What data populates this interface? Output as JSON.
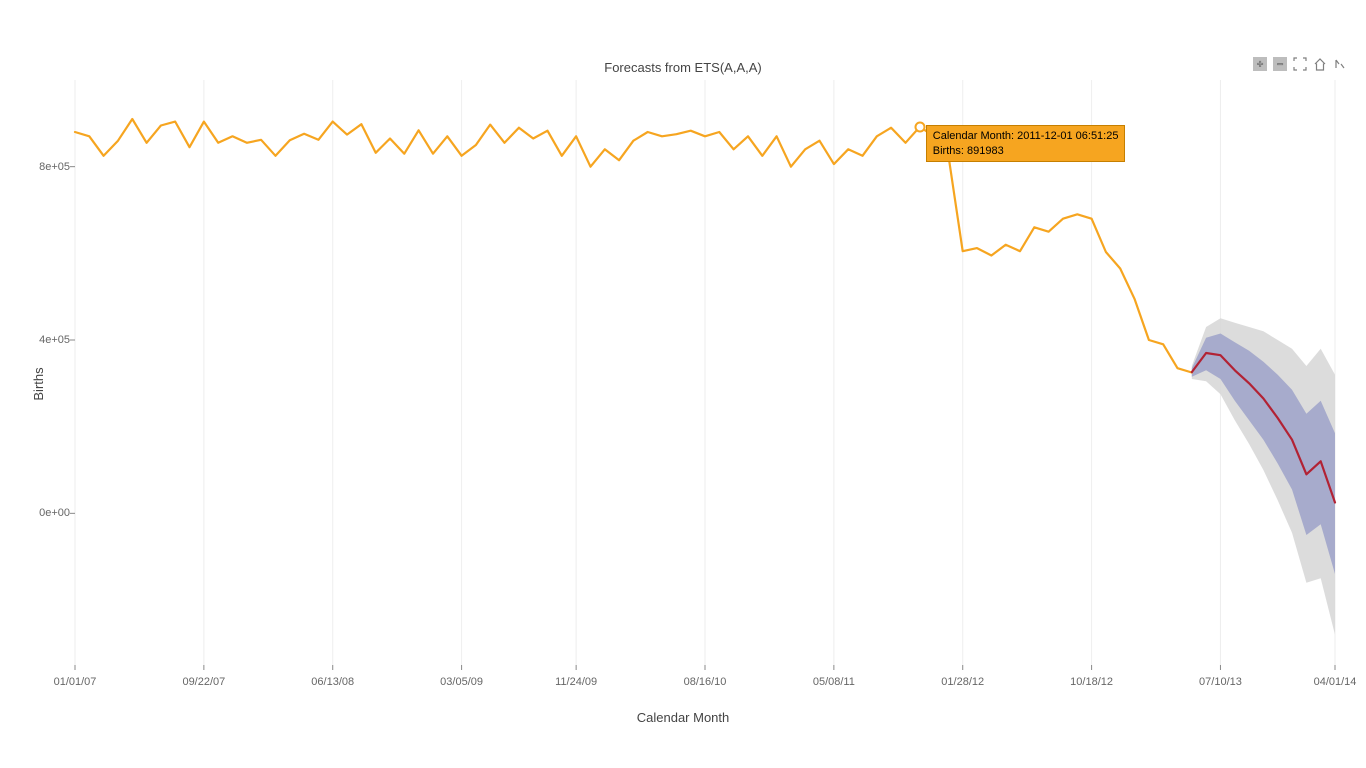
{
  "chart_data": {
    "type": "line",
    "title": "Forecasts from ETS(A,A,A)",
    "xlabel": "Calendar Month",
    "ylabel": "Births",
    "ylim": [
      -350000,
      1000000
    ],
    "xlim": [
      0,
      88
    ],
    "y_ticks": [
      {
        "v": 0,
        "label": "0e+00"
      },
      {
        "v": 400000,
        "label": "4e+05"
      },
      {
        "v": 800000,
        "label": "8e+05"
      }
    ],
    "x_ticks": [
      {
        "i": 0,
        "label": "01/01/07"
      },
      {
        "i": 9,
        "label": "09/22/07"
      },
      {
        "i": 18,
        "label": "06/13/08"
      },
      {
        "i": 27,
        "label": "03/05/09"
      },
      {
        "i": 35,
        "label": "11/24/09"
      },
      {
        "i": 44,
        "label": "08/16/10"
      },
      {
        "i": 53,
        "label": "05/08/11"
      },
      {
        "i": 62,
        "label": "01/28/12"
      },
      {
        "i": 71,
        "label": "10/18/12"
      },
      {
        "i": 80,
        "label": "07/10/13"
      },
      {
        "i": 88,
        "label": "04/01/14"
      }
    ],
    "series": [
      {
        "name": "Births",
        "color": "#f6a520",
        "values": [
          [
            0,
            880000
          ],
          [
            1,
            870000
          ],
          [
            2,
            825000
          ],
          [
            3,
            860000
          ],
          [
            4,
            910000
          ],
          [
            5,
            855000
          ],
          [
            6,
            895000
          ],
          [
            7,
            904000
          ],
          [
            8,
            845000
          ],
          [
            9,
            904000
          ],
          [
            10,
            855000
          ],
          [
            11,
            870000
          ],
          [
            12,
            855000
          ],
          [
            13,
            862000
          ],
          [
            14,
            825000
          ],
          [
            15,
            861000
          ],
          [
            16,
            876000
          ],
          [
            17,
            862000
          ],
          [
            18,
            904000
          ],
          [
            19,
            874000
          ],
          [
            20,
            898000
          ],
          [
            21,
            832000
          ],
          [
            22,
            865000
          ],
          [
            23,
            830000
          ],
          [
            24,
            884000
          ],
          [
            25,
            830000
          ],
          [
            26,
            870000
          ],
          [
            27,
            825000
          ],
          [
            28,
            850000
          ],
          [
            29,
            897000
          ],
          [
            30,
            855000
          ],
          [
            31,
            890000
          ],
          [
            32,
            865000
          ],
          [
            33,
            883000
          ],
          [
            34,
            825000
          ],
          [
            35,
            870000
          ],
          [
            36,
            800000
          ],
          [
            37,
            840000
          ],
          [
            38,
            815000
          ],
          [
            39,
            860000
          ],
          [
            40,
            880000
          ],
          [
            41,
            870000
          ],
          [
            42,
            875000
          ],
          [
            43,
            883000
          ],
          [
            44,
            870000
          ],
          [
            45,
            880000
          ],
          [
            46,
            840000
          ],
          [
            47,
            870000
          ],
          [
            48,
            825000
          ],
          [
            49,
            870000
          ],
          [
            50,
            800000
          ],
          [
            51,
            840000
          ],
          [
            52,
            860000
          ],
          [
            53,
            806000
          ],
          [
            54,
            840000
          ],
          [
            55,
            825000
          ],
          [
            56,
            870000
          ],
          [
            57,
            890000
          ],
          [
            58,
            855000
          ],
          [
            59,
            891983
          ],
          [
            60,
            870000
          ],
          [
            61,
            826000
          ],
          [
            62,
            605000
          ],
          [
            63,
            612000
          ],
          [
            64,
            595000
          ],
          [
            65,
            620000
          ],
          [
            66,
            605000
          ],
          [
            67,
            660000
          ],
          [
            68,
            650000
          ],
          [
            69,
            680000
          ],
          [
            70,
            690000
          ],
          [
            71,
            680000
          ],
          [
            72,
            603000
          ],
          [
            73,
            565000
          ],
          [
            74,
            495000
          ],
          [
            75,
            400000
          ],
          [
            76,
            390000
          ],
          [
            77,
            335000
          ],
          [
            78,
            325000
          ]
        ]
      },
      {
        "name": "Forecast",
        "color": "#b22234",
        "values": [
          [
            78,
            326000
          ],
          [
            79,
            370000
          ],
          [
            80,
            365000
          ],
          [
            81,
            330000
          ],
          [
            82,
            300000
          ],
          [
            83,
            265000
          ],
          [
            84,
            220000
          ],
          [
            85,
            170000
          ],
          [
            86,
            90000
          ],
          [
            87,
            120000
          ],
          [
            88,
            25000
          ]
        ]
      }
    ],
    "bands": [
      {
        "name": "ci95",
        "color": "#d6d6d6",
        "upper": [
          [
            78,
            340000
          ],
          [
            79,
            430000
          ],
          [
            80,
            450000
          ],
          [
            81,
            440000
          ],
          [
            82,
            430000
          ],
          [
            83,
            420000
          ],
          [
            84,
            400000
          ],
          [
            85,
            380000
          ],
          [
            86,
            340000
          ],
          [
            87,
            380000
          ],
          [
            88,
            320000
          ]
        ],
        "lower": [
          [
            78,
            310000
          ],
          [
            79,
            305000
          ],
          [
            80,
            275000
          ],
          [
            81,
            215000
          ],
          [
            82,
            160000
          ],
          [
            83,
            100000
          ],
          [
            84,
            30000
          ],
          [
            85,
            -45000
          ],
          [
            86,
            -160000
          ],
          [
            87,
            -150000
          ],
          [
            88,
            -280000
          ]
        ]
      },
      {
        "name": "ci80",
        "color": "#9da2c9",
        "upper": [
          [
            78,
            335000
          ],
          [
            79,
            405000
          ],
          [
            80,
            415000
          ],
          [
            81,
            395000
          ],
          [
            82,
            375000
          ],
          [
            83,
            350000
          ],
          [
            84,
            320000
          ],
          [
            85,
            285000
          ],
          [
            86,
            230000
          ],
          [
            87,
            260000
          ],
          [
            88,
            185000
          ]
        ],
        "lower": [
          [
            78,
            315000
          ],
          [
            79,
            330000
          ],
          [
            80,
            310000
          ],
          [
            81,
            260000
          ],
          [
            82,
            215000
          ],
          [
            83,
            170000
          ],
          [
            84,
            115000
          ],
          [
            85,
            55000
          ],
          [
            86,
            -50000
          ],
          [
            87,
            -25000
          ],
          [
            88,
            -140000
          ]
        ]
      }
    ],
    "tooltip": {
      "series_index": 0,
      "point_index": 59,
      "lines": [
        "Calendar Month: 2011-12-01 06:51:25",
        "Births: 891983"
      ]
    }
  },
  "toolbar": {
    "items": [
      "plus",
      "minus",
      "fullscreen",
      "home",
      "format"
    ]
  }
}
